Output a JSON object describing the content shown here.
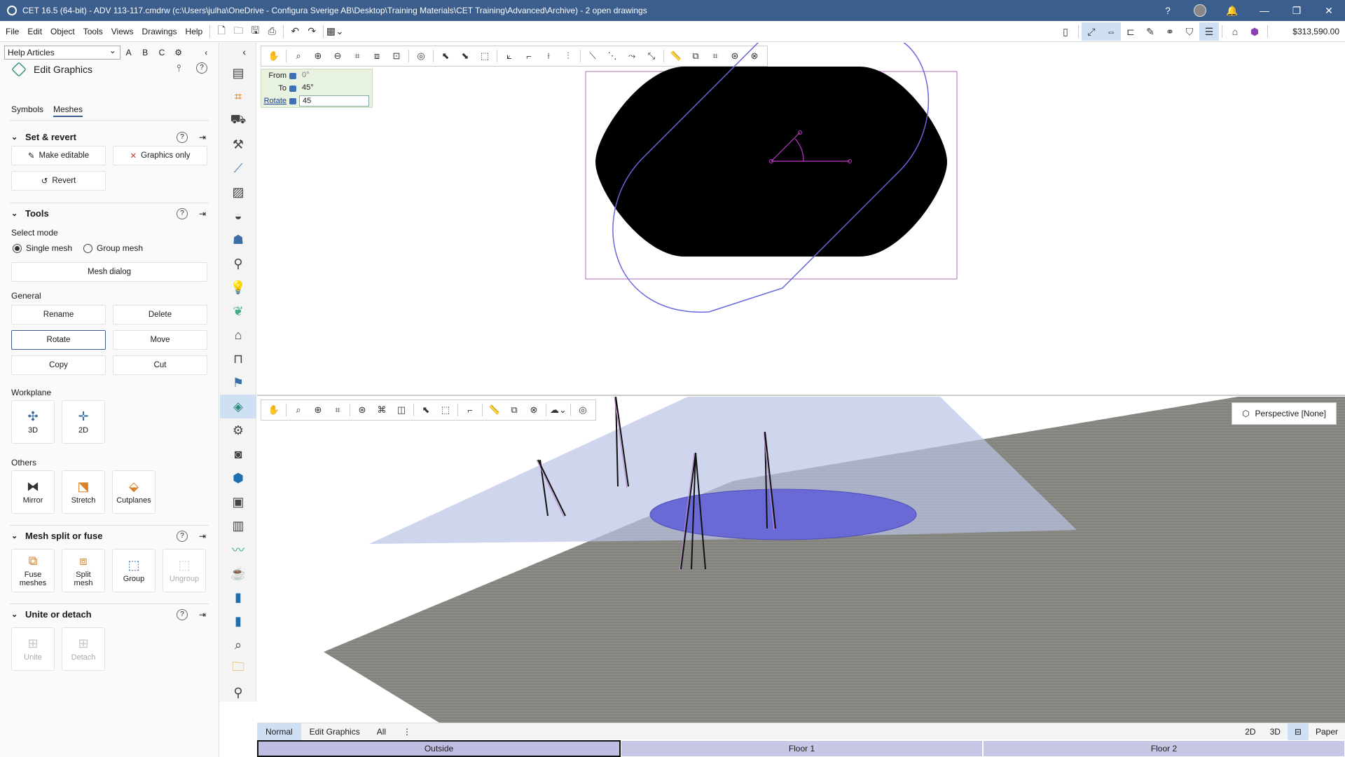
{
  "titlebar": {
    "title": "CET 16.5 (64-bit) - ADV 113-117.cmdrw (c:\\Users\\julha\\OneDrive - Configura Sverige AB\\Desktop\\Training Materials\\CET Training\\Advanced\\Archive) - 2  open drawings",
    "controls": [
      "?",
      "🔔",
      "—",
      "❐",
      "✕"
    ]
  },
  "menubar": {
    "items": [
      "File",
      "Edit",
      "Object",
      "Tools",
      "Views",
      "Drawings",
      "Help"
    ],
    "price": "$313,590.00"
  },
  "left": {
    "help_select": "Help Articles",
    "letters": [
      "A",
      "B",
      "C"
    ],
    "panel_title": "Edit Graphics",
    "tabs": [
      "Symbols",
      "Meshes"
    ],
    "set_revert": {
      "title": "Set & revert",
      "make_editable": "Make editable",
      "graphics_only": "Graphics only",
      "revert": "Revert"
    },
    "tools": {
      "title": "Tools",
      "select_mode_label": "Select mode",
      "single_mesh": "Single mesh",
      "group_mesh": "Group mesh",
      "mesh_dialog": "Mesh dialog",
      "general_label": "General",
      "rename": "Rename",
      "delete": "Delete",
      "rotate": "Rotate",
      "move": "Move",
      "copy": "Copy",
      "cut": "Cut",
      "workplane_label": "Workplane",
      "wp_3d": "3D",
      "wp_2d": "2D",
      "others_label": "Others",
      "mirror": "Mirror",
      "stretch": "Stretch",
      "cutplanes": "Cutplanes"
    },
    "split_fuse": {
      "title": "Mesh split or fuse",
      "fuse": "Fuse meshes",
      "split": "Split mesh",
      "group": "Group",
      "ungroup": "Ungroup"
    },
    "unite_detach": {
      "title": "Unite or detach",
      "unite": "Unite",
      "detach": "Detach"
    }
  },
  "rotate_panel": {
    "from_label": "From",
    "from_value": "0°",
    "to_label": "To",
    "to_value": "45°",
    "rotate_label": "Rotate",
    "rotate_value": "45"
  },
  "view3d": {
    "perspective": "Perspective [None]"
  },
  "bottom": {
    "tabs": [
      "Normal",
      "Edit Graphics",
      "All"
    ],
    "right": [
      "2D",
      "3D",
      "Paper"
    ],
    "floors": [
      "Outside",
      "Floor 1",
      "Floor 2"
    ]
  },
  "colors": {
    "titlebar": "#3b5e8c",
    "selection": "#6666dd",
    "handle": "#c03bc8",
    "table_top_3d": "#6a6ad6"
  }
}
